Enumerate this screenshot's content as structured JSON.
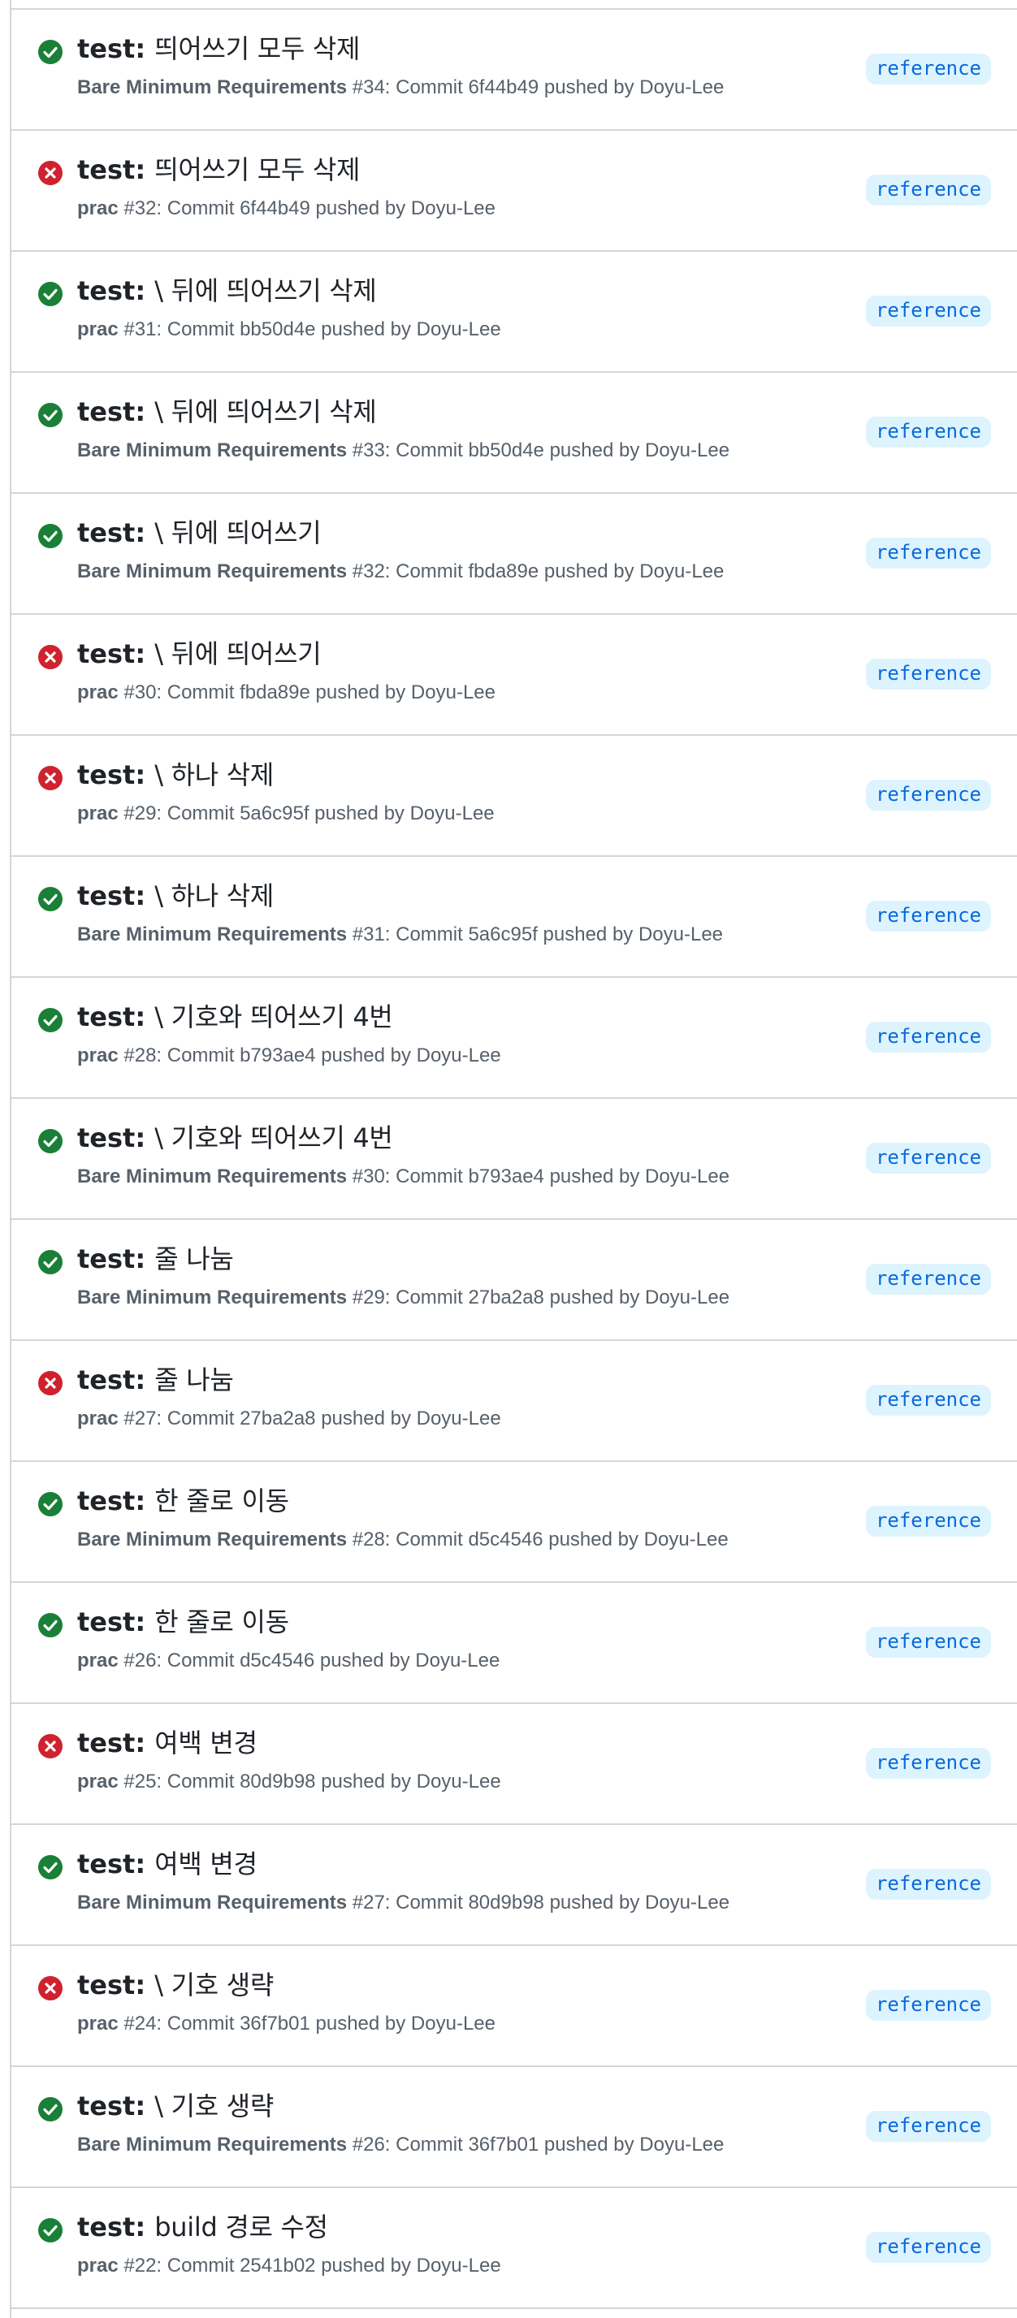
{
  "colors": {
    "success": "#1a7f37",
    "failure": "#cf222e",
    "badge_bg": "#ddf4ff",
    "badge_fg": "#0969da",
    "border": "#d0d7de",
    "muted": "#57606a"
  },
  "runs": [
    {
      "status": "success",
      "icon": "check-circle-icon",
      "title_prefix": "test:",
      "title_rest": "띄어쓰기 모두 삭제",
      "workflow": "Bare Minimum Requirements",
      "details": "#34: Commit 6f44b49 pushed by Doyu-Lee",
      "badge": "reference"
    },
    {
      "status": "failure",
      "icon": "x-circle-icon",
      "title_prefix": "test:",
      "title_rest": "띄어쓰기 모두 삭제",
      "workflow": "prac",
      "details": "#32: Commit 6f44b49 pushed by Doyu-Lee",
      "badge": "reference"
    },
    {
      "status": "success",
      "icon": "check-circle-icon",
      "title_prefix": "test:",
      "title_rest": "\\ 뒤에 띄어쓰기 삭제",
      "workflow": "prac",
      "details": "#31: Commit bb50d4e pushed by Doyu-Lee",
      "badge": "reference"
    },
    {
      "status": "success",
      "icon": "check-circle-icon",
      "title_prefix": "test:",
      "title_rest": "\\ 뒤에 띄어쓰기 삭제",
      "workflow": "Bare Minimum Requirements",
      "details": "#33: Commit bb50d4e pushed by Doyu-Lee",
      "badge": "reference"
    },
    {
      "status": "success",
      "icon": "check-circle-icon",
      "title_prefix": "test:",
      "title_rest": "\\ 뒤에 띄어쓰기",
      "workflow": "Bare Minimum Requirements",
      "details": "#32: Commit fbda89e pushed by Doyu-Lee",
      "badge": "reference"
    },
    {
      "status": "failure",
      "icon": "x-circle-icon",
      "title_prefix": "test:",
      "title_rest": "\\ 뒤에 띄어쓰기",
      "workflow": "prac",
      "details": "#30: Commit fbda89e pushed by Doyu-Lee",
      "badge": "reference"
    },
    {
      "status": "failure",
      "icon": "x-circle-icon",
      "title_prefix": "test:",
      "title_rest": "\\ 하나 삭제",
      "workflow": "prac",
      "details": "#29: Commit 5a6c95f pushed by Doyu-Lee",
      "badge": "reference"
    },
    {
      "status": "success",
      "icon": "check-circle-icon",
      "title_prefix": "test:",
      "title_rest": "\\ 하나 삭제",
      "workflow": "Bare Minimum Requirements",
      "details": "#31: Commit 5a6c95f pushed by Doyu-Lee",
      "badge": "reference"
    },
    {
      "status": "success",
      "icon": "check-circle-icon",
      "title_prefix": "test:",
      "title_rest": "\\ 기호와 띄어쓰기 4번",
      "workflow": "prac",
      "details": "#28: Commit b793ae4 pushed by Doyu-Lee",
      "badge": "reference"
    },
    {
      "status": "success",
      "icon": "check-circle-icon",
      "title_prefix": "test:",
      "title_rest": "\\ 기호와 띄어쓰기 4번",
      "workflow": "Bare Minimum Requirements",
      "details": "#30: Commit b793ae4 pushed by Doyu-Lee",
      "badge": "reference"
    },
    {
      "status": "success",
      "icon": "check-circle-icon",
      "title_prefix": "test:",
      "title_rest": "줄 나눔",
      "workflow": "Bare Minimum Requirements",
      "details": "#29: Commit 27ba2a8 pushed by Doyu-Lee",
      "badge": "reference"
    },
    {
      "status": "failure",
      "icon": "x-circle-icon",
      "title_prefix": "test:",
      "title_rest": "줄 나눔",
      "workflow": "prac",
      "details": "#27: Commit 27ba2a8 pushed by Doyu-Lee",
      "badge": "reference"
    },
    {
      "status": "success",
      "icon": "check-circle-icon",
      "title_prefix": "test:",
      "title_rest": "한 줄로 이동",
      "workflow": "Bare Minimum Requirements",
      "details": "#28: Commit d5c4546 pushed by Doyu-Lee",
      "badge": "reference"
    },
    {
      "status": "success",
      "icon": "check-circle-icon",
      "title_prefix": "test:",
      "title_rest": "한 줄로 이동",
      "workflow": "prac",
      "details": "#26: Commit d5c4546 pushed by Doyu-Lee",
      "badge": "reference"
    },
    {
      "status": "failure",
      "icon": "x-circle-icon",
      "title_prefix": "test:",
      "title_rest": "여백 변경",
      "workflow": "prac",
      "details": "#25: Commit 80d9b98 pushed by Doyu-Lee",
      "badge": "reference"
    },
    {
      "status": "success",
      "icon": "check-circle-icon",
      "title_prefix": "test:",
      "title_rest": "여백 변경",
      "workflow": "Bare Minimum Requirements",
      "details": "#27: Commit 80d9b98 pushed by Doyu-Lee",
      "badge": "reference"
    },
    {
      "status": "failure",
      "icon": "x-circle-icon",
      "title_prefix": "test:",
      "title_rest": "\\ 기호 생략",
      "workflow": "prac",
      "details": "#24: Commit 36f7b01 pushed by Doyu-Lee",
      "badge": "reference"
    },
    {
      "status": "success",
      "icon": "check-circle-icon",
      "title_prefix": "test:",
      "title_rest": "\\ 기호 생략",
      "workflow": "Bare Minimum Requirements",
      "details": "#26: Commit 36f7b01 pushed by Doyu-Lee",
      "badge": "reference"
    },
    {
      "status": "success",
      "icon": "check-circle-icon",
      "title_prefix": "test:",
      "title_rest": "build 경로 수정",
      "workflow": "prac",
      "details": "#22: Commit 2541b02 pushed by Doyu-Lee",
      "badge": "reference"
    }
  ]
}
